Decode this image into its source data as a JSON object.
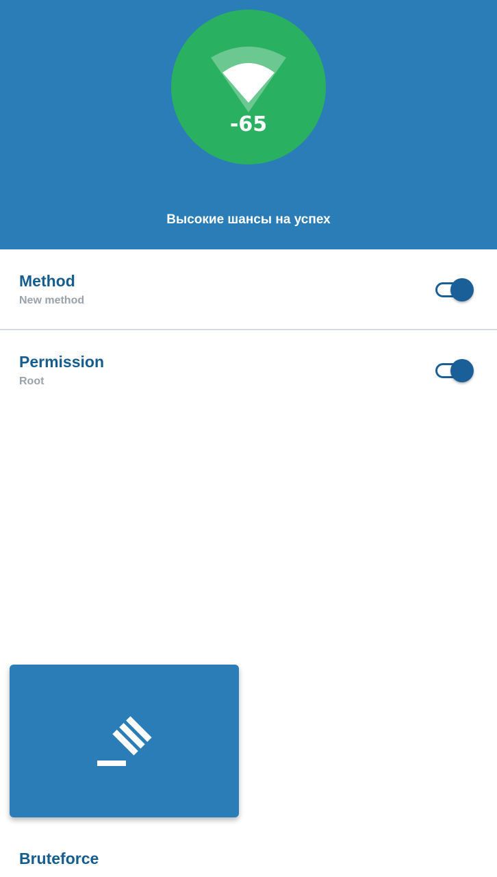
{
  "signal": {
    "icon": "wifi-icon",
    "value": "-65",
    "color": "#2ab061"
  },
  "status": {
    "text": "Высокие шансы на успех"
  },
  "settings": [
    {
      "title": "Method",
      "subtitle": "New method",
      "enabled": true
    },
    {
      "title": "Permission",
      "subtitle": "Root",
      "enabled": true
    }
  ],
  "card": {
    "icon": "gavel-icon",
    "label": "Bruteforce"
  },
  "colors": {
    "primary": "#2a7db7",
    "accent": "#1a5f98",
    "title_text": "#155d8f",
    "subtitle_text": "#9aa3a9"
  }
}
